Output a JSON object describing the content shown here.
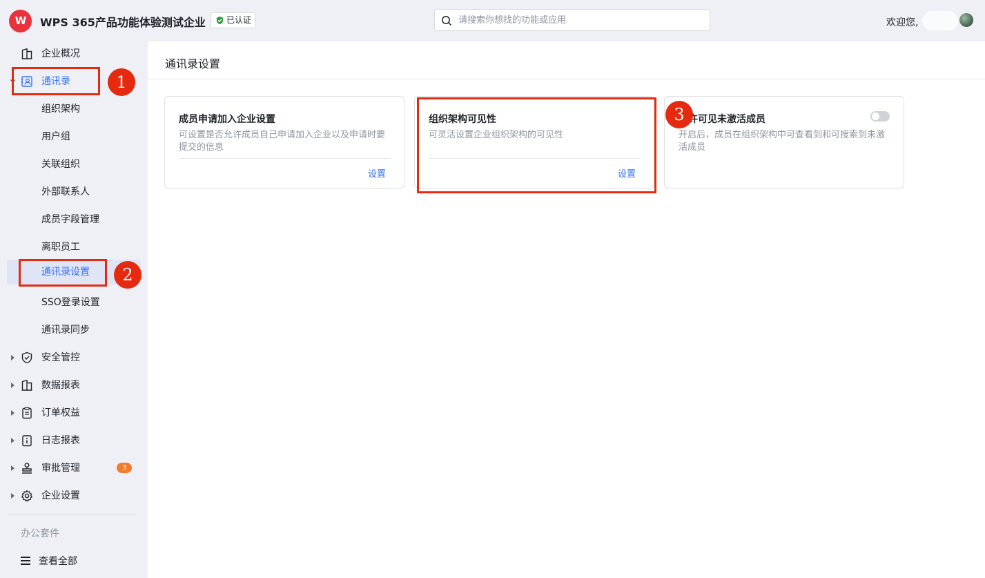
{
  "header": {
    "logo_text": "W",
    "company": "WPS 365产品功能体验测试企业",
    "verified": "已认证",
    "search_placeholder": "请搜索你想找的功能或应用",
    "welcome": "欢迎您,"
  },
  "sidebar": {
    "items": [
      {
        "label": "企业概况",
        "icon": "building-icon"
      },
      {
        "label": "通讯录",
        "icon": "contacts-icon"
      },
      {
        "label": "组织架构"
      },
      {
        "label": "用户组"
      },
      {
        "label": "关联组织"
      },
      {
        "label": "外部联系人"
      },
      {
        "label": "成员字段管理"
      },
      {
        "label": "离职员工"
      },
      {
        "label": "通讯录设置"
      },
      {
        "label": "SSO登录设置"
      },
      {
        "label": "通讯录同步"
      },
      {
        "label": "安全管控",
        "icon": "shield-icon"
      },
      {
        "label": "数据报表",
        "icon": "report-icon"
      },
      {
        "label": "订单权益",
        "icon": "clipboard-icon"
      },
      {
        "label": "日志报表",
        "icon": "info-doc-icon"
      },
      {
        "label": "审批管理",
        "icon": "stamp-icon",
        "badge": "3"
      },
      {
        "label": "企业设置",
        "icon": "gear-icon"
      }
    ],
    "section_label": "办公套件",
    "view_all": "查看全部"
  },
  "main": {
    "title": "通讯录设置",
    "cards": [
      {
        "title": "成员申请加入企业设置",
        "desc": "可设置是否允许成员自己申请加入企业以及申请时要提交的信息",
        "link": "设置"
      },
      {
        "title": "组织架构可见性",
        "desc": "可灵活设置企业组织架构的可见性",
        "link": "设置"
      },
      {
        "title": "允许可见未激活成员",
        "desc": "开启后，成员在组织架构中可查看到和可搜索到未激活成员",
        "toggle_on": false
      }
    ]
  },
  "annotations": [
    "1",
    "2",
    "3"
  ],
  "colors": {
    "accent": "#3370ff",
    "annotation": "#e62a10",
    "brand": "#e8333c"
  }
}
